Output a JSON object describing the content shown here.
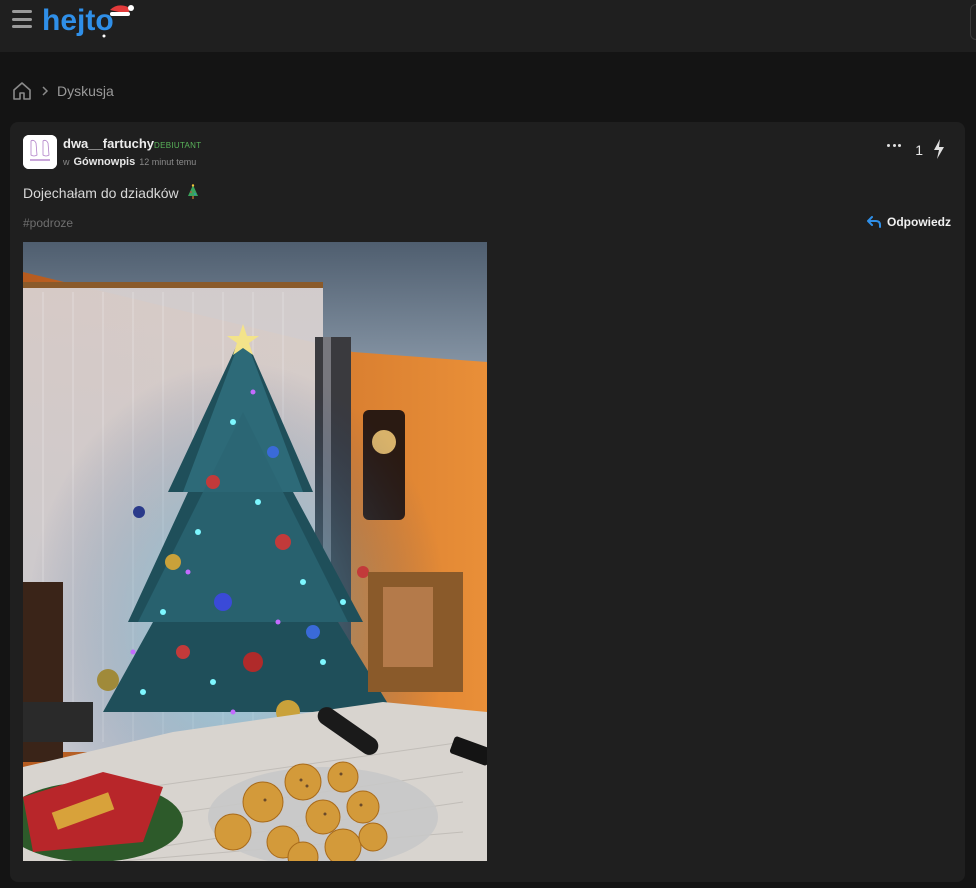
{
  "header": {
    "logo_text": "hejto",
    "menu_icon": "hamburger-menu-icon"
  },
  "breadcrumb": {
    "home_icon": "home-icon",
    "separator_icon": "chevron-right-icon",
    "current": "Dyskusja"
  },
  "post": {
    "author": {
      "username": "dwa__fartuchy",
      "rank": "DEBIUTANT",
      "avatar_icon": "avatar"
    },
    "in_label": "w",
    "community": "Gównowpis",
    "time_ago": "12 minut temu",
    "content": "Dojechałam do dziadków",
    "content_emoji": "christmas-tree-emoji",
    "tag": "#podroze",
    "actions": {
      "more_icon": "more-dots-icon",
      "votes": "1",
      "vote_icon": "lightning-bolt-icon",
      "reply_label": "Odpowiedz",
      "reply_icon": "reply-arrow-icon"
    },
    "image": {
      "description_icon": "post-photo"
    }
  },
  "colors": {
    "background": "#141414",
    "card": "#1f1f1f",
    "accent_blue": "#2f8fe8",
    "rank_green": "#59b35a"
  }
}
